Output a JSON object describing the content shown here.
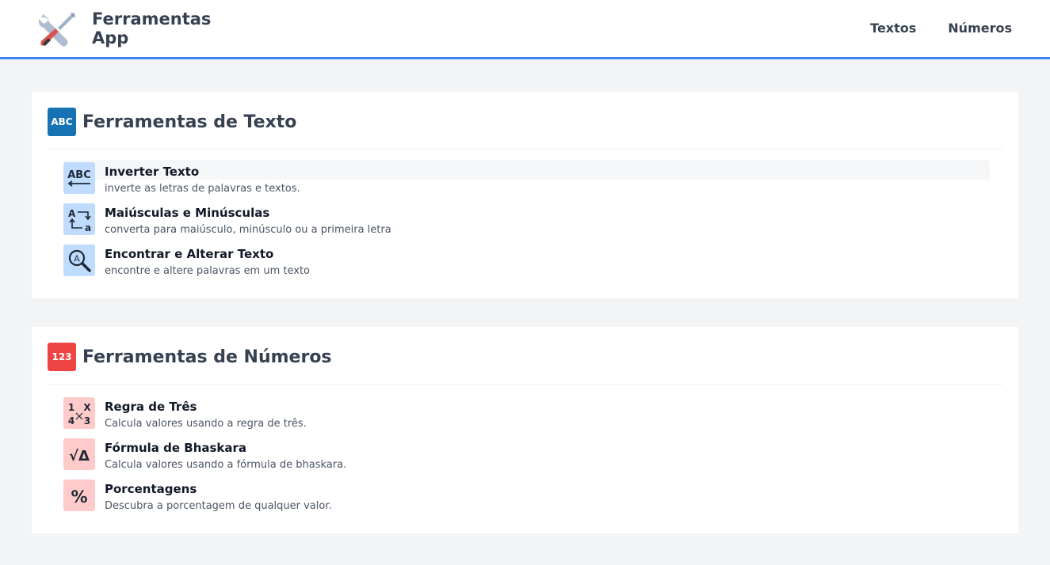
{
  "header": {
    "app_name": "Ferramentas\nApp",
    "logo_icon": "wrench-screwdriver-icon",
    "nav": [
      {
        "label": "Textos"
      },
      {
        "label": "Números"
      }
    ],
    "accent_color": "#3b82f6"
  },
  "sections": [
    {
      "badge": "ABC",
      "badge_color": "#1672b3",
      "title": "Ferramentas de Texto",
      "tools": [
        {
          "name": "Inverter Texto",
          "desc": "inverte as letras de palavras e textos.",
          "icon": "abc-reverse-icon"
        },
        {
          "name": "Maiúsculas e Minúsculas",
          "desc": "converta para maiúsculo, minúsculo ou a primeira letra",
          "icon": "letter-case-icon"
        },
        {
          "name": "Encontrar e Alterar Texto",
          "desc": "encontre e altere palavras em um texto",
          "icon": "search-text-icon"
        }
      ]
    },
    {
      "badge": "123",
      "badge_color": "#ef4444",
      "title": "Ferramentas de Números",
      "tools": [
        {
          "name": "Regra de Três",
          "desc": "Calcula valores usando a regra de três.",
          "icon": "rule-of-three-icon",
          "glyphs": [
            "1",
            "X",
            "4",
            "3"
          ]
        },
        {
          "name": "Fórmula de Bhaskara",
          "desc": "Calcula valores usando a fórmula de bhaskara.",
          "icon": "sqrt-delta-icon",
          "glyph": "√Δ"
        },
        {
          "name": "Porcentagens",
          "desc": "Descubra a porcentagem de qualquer valor.",
          "icon": "percent-icon",
          "glyph": "%"
        }
      ]
    }
  ]
}
